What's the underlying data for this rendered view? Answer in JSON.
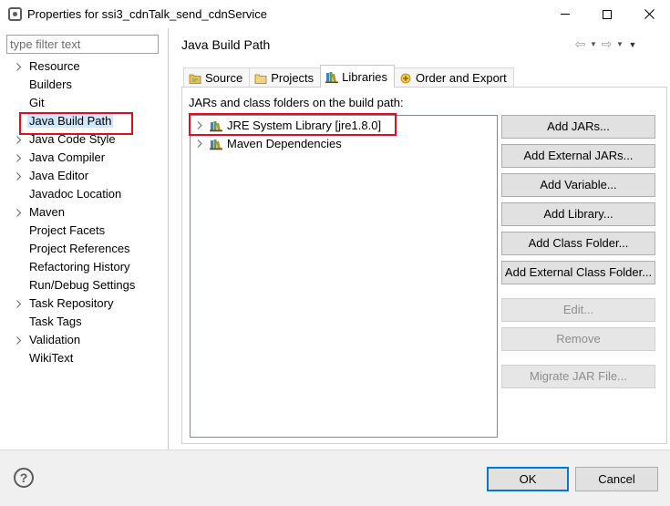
{
  "window": {
    "title": "Properties for ssi3_cdnTalk_send_cdnService",
    "minimize_icon": "minimize-icon",
    "maximize_icon": "maximize-icon",
    "close_icon": "close-icon"
  },
  "filter": {
    "placeholder": "type filter text",
    "value": ""
  },
  "nav": {
    "selected": "Java Build Path",
    "items": [
      {
        "label": "Resource",
        "expandable": true
      },
      {
        "label": "Builders",
        "expandable": false
      },
      {
        "label": "Git",
        "expandable": false
      },
      {
        "label": "Java Build Path",
        "expandable": false
      },
      {
        "label": "Java Code Style",
        "expandable": true
      },
      {
        "label": "Java Compiler",
        "expandable": true
      },
      {
        "label": "Java Editor",
        "expandable": true
      },
      {
        "label": "Javadoc Location",
        "expandable": false
      },
      {
        "label": "Maven",
        "expandable": true
      },
      {
        "label": "Project Facets",
        "expandable": false
      },
      {
        "label": "Project References",
        "expandable": false
      },
      {
        "label": "Refactoring History",
        "expandable": false
      },
      {
        "label": "Run/Debug Settings",
        "expandable": false
      },
      {
        "label": "Task Repository",
        "expandable": true
      },
      {
        "label": "Task Tags",
        "expandable": false
      },
      {
        "label": "Validation",
        "expandable": true
      },
      {
        "label": "WikiText",
        "expandable": false
      }
    ]
  },
  "page": {
    "title": "Java Build Path",
    "back_icon": "back-arrow-icon",
    "forward_icon": "forward-arrow-icon",
    "menu_icon": "view-menu-icon"
  },
  "tabs": [
    {
      "label": "Source",
      "icon": "source-folder-icon",
      "active": false
    },
    {
      "label": "Projects",
      "icon": "projects-folder-icon",
      "active": false
    },
    {
      "label": "Libraries",
      "icon": "libraries-icon",
      "active": true
    },
    {
      "label": "Order and Export",
      "icon": "order-export-icon",
      "active": false
    }
  ],
  "libraries": {
    "heading": "JARs and class folders on the build path:",
    "entries": [
      {
        "label": "JRE System Library [jre1.8.0]",
        "icon": "library-icon"
      },
      {
        "label": "Maven Dependencies",
        "icon": "library-icon"
      }
    ],
    "buttons": [
      {
        "label": "Add JARs...",
        "enabled": true
      },
      {
        "label": "Add External JARs...",
        "enabled": true
      },
      {
        "label": "Add Variable...",
        "enabled": true
      },
      {
        "label": "Add Library...",
        "enabled": true
      },
      {
        "label": "Add Class Folder...",
        "enabled": true
      },
      {
        "label": "Add External Class Folder...",
        "enabled": true
      },
      {
        "label": "Edit...",
        "enabled": false
      },
      {
        "label": "Remove",
        "enabled": false
      },
      {
        "label": "Migrate JAR File...",
        "enabled": false
      }
    ]
  },
  "footer": {
    "help_icon": "help-icon",
    "help_glyph": "?",
    "ok_label": "OK",
    "cancel_label": "Cancel"
  },
  "colors": {
    "selection": "#cce8ff",
    "highlight_border": "#e0101a",
    "default_button_border": "#0078d7"
  }
}
